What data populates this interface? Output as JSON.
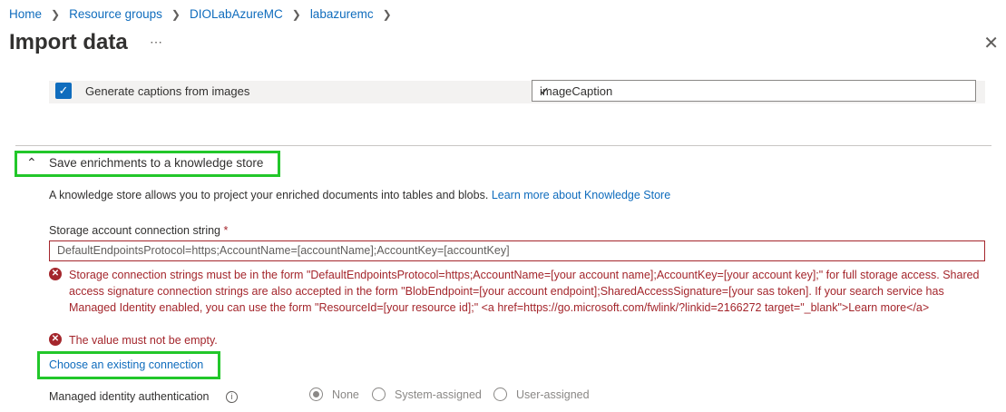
{
  "breadcrumb": {
    "items": [
      "Home",
      "Resource groups",
      "DIOLabAzureMC",
      "labazuremc"
    ],
    "separator": ">"
  },
  "header": {
    "title": "Import data",
    "more_icon": "ellipsis-icon",
    "close_icon": "close-icon"
  },
  "captions": {
    "checkbox_label": "Generate captions from images",
    "checked": true,
    "field_value": "imageCaption"
  },
  "knowledge_store": {
    "section_label": "Save enrichments to a knowledge store",
    "expanded": true,
    "description": "A knowledge store allows you to project your enriched documents into tables and blobs.",
    "learn_more": "Learn more about Knowledge Store",
    "conn_label": "Storage account connection string",
    "required_mark": "*",
    "conn_value": "DefaultEndpointsProtocol=https;AccountName=[accountName];AccountKey=[accountKey]",
    "error_format": "Storage connection strings must be in the form \"DefaultEndpointsProtocol=https;AccountName=[your account name];AccountKey=[your account key];\" for full storage access. Shared access signature connection strings are also accepted in the form \"BlobEndpoint=[your account endpoint];SharedAccessSignature=[your sas token]. If your search service has Managed Identity enabled, you can use the form \"ResourceId=[your resource id];\" <a href=https://go.microsoft.com/fwlink/?linkid=2166272 target=\"_blank\">Learn more</a>",
    "error_empty": "The value must not be empty.",
    "choose_link": "Choose an existing connection",
    "managed_identity_label": "Managed identity authentication",
    "identity_options": [
      "None",
      "System-assigned",
      "User-assigned"
    ],
    "identity_selected": "None"
  },
  "colors": {
    "accent": "#0f6cbd",
    "error": "#a4262c",
    "highlight": "#22c72a",
    "valid": "#57a300"
  }
}
